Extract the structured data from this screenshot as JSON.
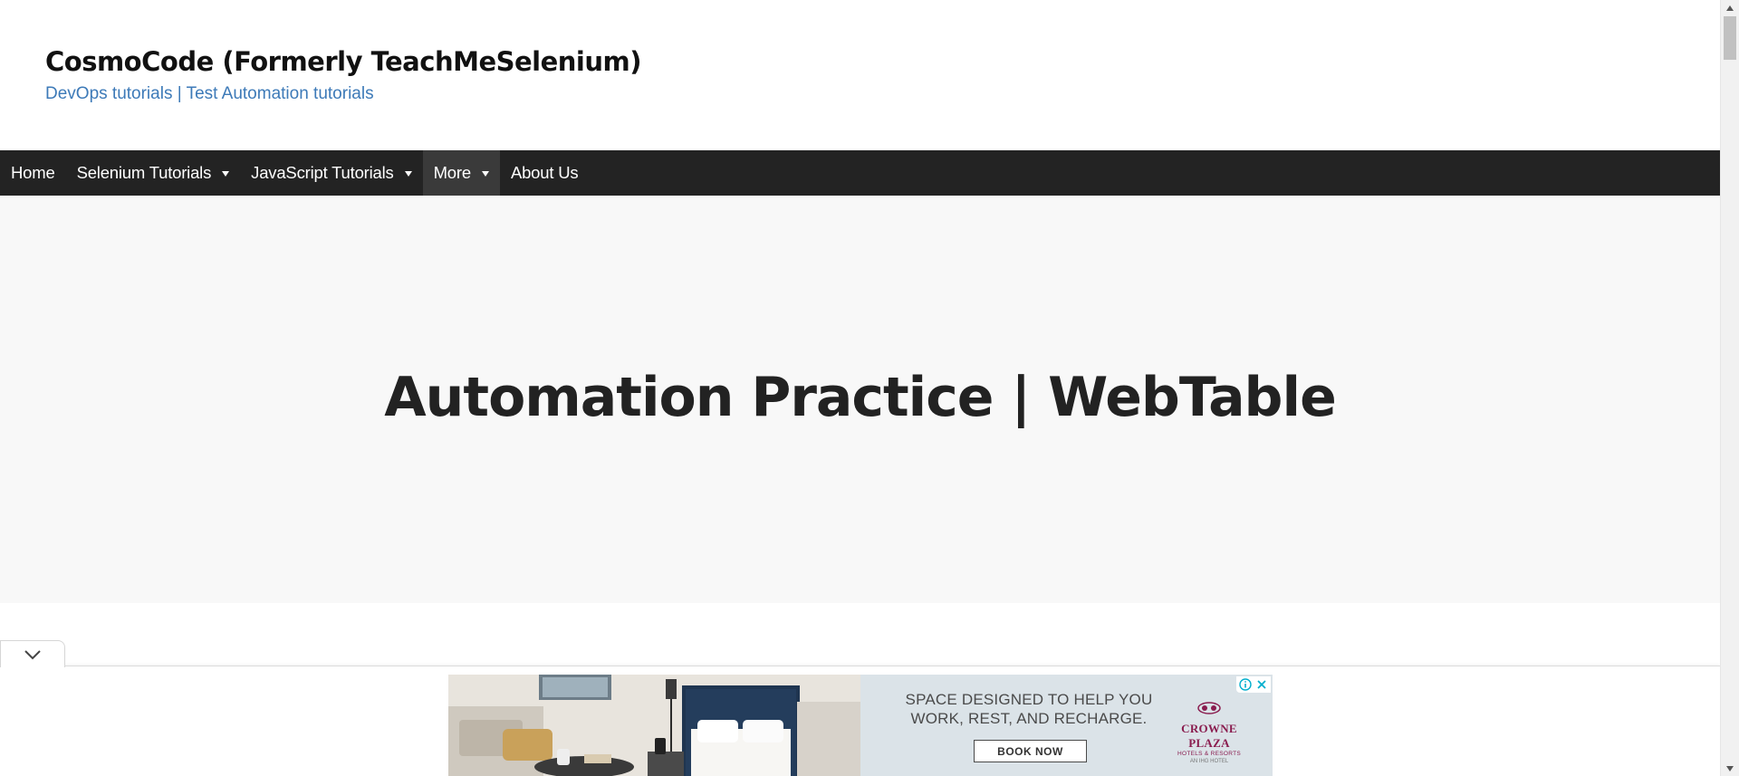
{
  "header": {
    "site_title": "CosmoCode (Formerly TeachMeSelenium)",
    "tagline": "DevOps tutorials | Test Automation tutorials"
  },
  "nav": {
    "items": [
      {
        "label": "Home",
        "has_dropdown": false,
        "active": false
      },
      {
        "label": "Selenium Tutorials",
        "has_dropdown": true,
        "active": false
      },
      {
        "label": "JavaScript Tutorials",
        "has_dropdown": true,
        "active": false
      },
      {
        "label": "More",
        "has_dropdown": true,
        "active": true
      },
      {
        "label": "About Us",
        "has_dropdown": false,
        "active": false
      }
    ]
  },
  "hero": {
    "title": "Automation Practice | WebTable"
  },
  "ad": {
    "headline": "SPACE DESIGNED TO HELP YOU WORK, REST, AND RECHARGE.",
    "cta": "BOOK NOW",
    "brand_name": "CROWNE PLAZA",
    "brand_sub": "HOTELS & RESORTS",
    "brand_sub2": "AN IHG HOTEL"
  },
  "colors": {
    "nav_background": "#232323",
    "nav_active": "#3a3a3a",
    "tagline": "#3d7ab8",
    "hero_background": "#f8f8f8",
    "ad_brand": "#8a1d4f",
    "ad_controls": "#00aecd"
  },
  "icons": {
    "dock_toggle": "chevron-down-icon",
    "ad_info": "info-icon",
    "ad_close": "close-icon",
    "brand_logo": "crowne-plaza-logo"
  }
}
